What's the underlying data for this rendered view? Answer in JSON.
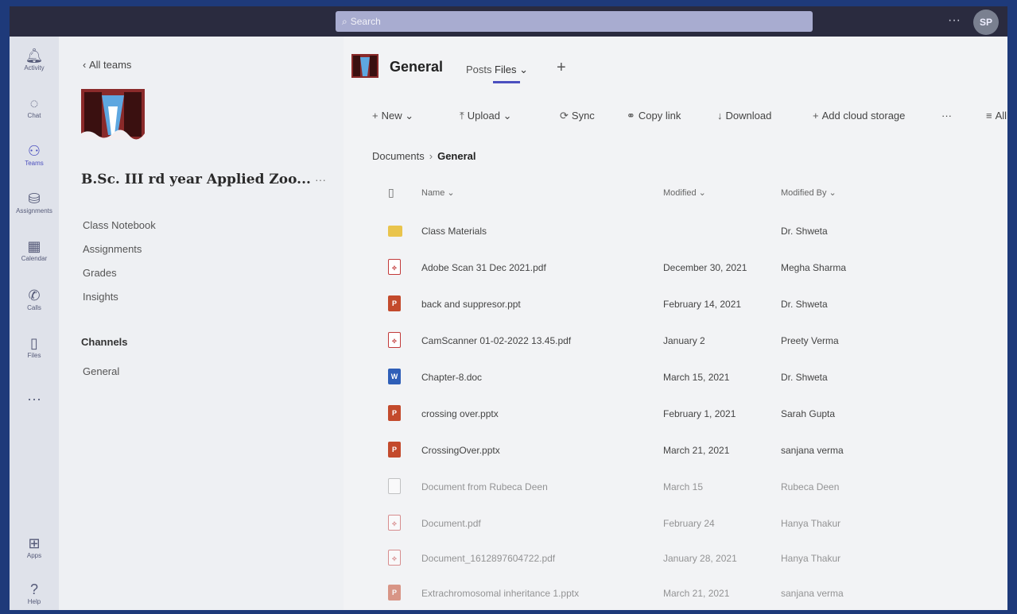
{
  "search": {
    "placeholder": "Search"
  },
  "topbar": {
    "more": "···",
    "avatar_initials": "SP"
  },
  "rail": [
    {
      "label": "Activity",
      "icon": "bell-icon"
    },
    {
      "label": "Chat",
      "icon": "chat-icon"
    },
    {
      "label": "Teams",
      "icon": "teams-icon"
    },
    {
      "label": "Assignments",
      "icon": "assignments-icon"
    },
    {
      "label": "Calendar",
      "icon": "calendar-icon"
    },
    {
      "label": "Calls",
      "icon": "phone-icon"
    },
    {
      "label": "Files",
      "icon": "file-icon"
    },
    {
      "label": "···",
      "icon": "more-icon"
    },
    {
      "label": "Apps",
      "icon": "apps-icon"
    },
    {
      "label": "Help",
      "icon": "help-icon"
    }
  ],
  "team_panel": {
    "back_label": "All teams",
    "team_name": "B.Sc. III rd year Applied Zoo...",
    "more": "···",
    "nav": [
      "Class Notebook",
      "Assignments",
      "Grades",
      "Insights"
    ],
    "channels_heading": "Channels",
    "channels": [
      "General"
    ]
  },
  "channel": {
    "title": "General",
    "tabs": [
      "Posts",
      "Files"
    ],
    "add_tab": "+"
  },
  "toolbar": {
    "new": "New",
    "upload": "Upload",
    "sync": "Sync",
    "copy_link": "Copy link",
    "download": "Download",
    "add_cloud": "Add cloud storage",
    "more": "···",
    "all": "All"
  },
  "breadcrumb": {
    "root": "Documents",
    "current": "General"
  },
  "columns": {
    "name": "Name",
    "modified": "Modified",
    "modified_by": "Modified By"
  },
  "files": [
    {
      "name": "Class Materials",
      "modified": "",
      "by": "Dr. Shweta",
      "type": "folder"
    },
    {
      "name": "Adobe Scan 31 Dec 2021.pdf",
      "modified": "December 30, 2021",
      "by": "Megha Sharma",
      "type": "pdf"
    },
    {
      "name": "back and suppresor.ppt",
      "modified": "February 14, 2021",
      "by": "Dr. Shweta",
      "type": "ppt"
    },
    {
      "name": "CamScanner 01-02-2022 13.45.pdf",
      "modified": "January 2",
      "by": "Preety Verma",
      "type": "pdf"
    },
    {
      "name": "Chapter-8.doc",
      "modified": "March 15, 2021",
      "by": "Dr. Shweta",
      "type": "doc"
    },
    {
      "name": "crossing over.pptx",
      "modified": "February 1, 2021",
      "by": "Sarah Gupta",
      "type": "ppt"
    },
    {
      "name": "CrossingOver.pptx",
      "modified": "March 21, 2021",
      "by": "sanjana verma",
      "type": "ppt"
    },
    {
      "name": "Document from Rubeca Deen",
      "modified": "March 15",
      "by": "Rubeca Deen",
      "type": "blank"
    },
    {
      "name": "Document.pdf",
      "modified": "February 24",
      "by": "Hanya Thakur",
      "type": "pdf"
    },
    {
      "name": "Document_1612897604722.pdf",
      "modified": "January 28, 2021",
      "by": "Hanya Thakur",
      "type": "pdf"
    },
    {
      "name": "Extrachromosomal inheritance 1.pptx",
      "modified": "March 21, 2021",
      "by": "sanjana verma",
      "type": "ppt"
    }
  ],
  "colors": {
    "accent": "#4b4fbf",
    "topbar": "#2a2b3f",
    "frame": "#1e3a7a"
  }
}
